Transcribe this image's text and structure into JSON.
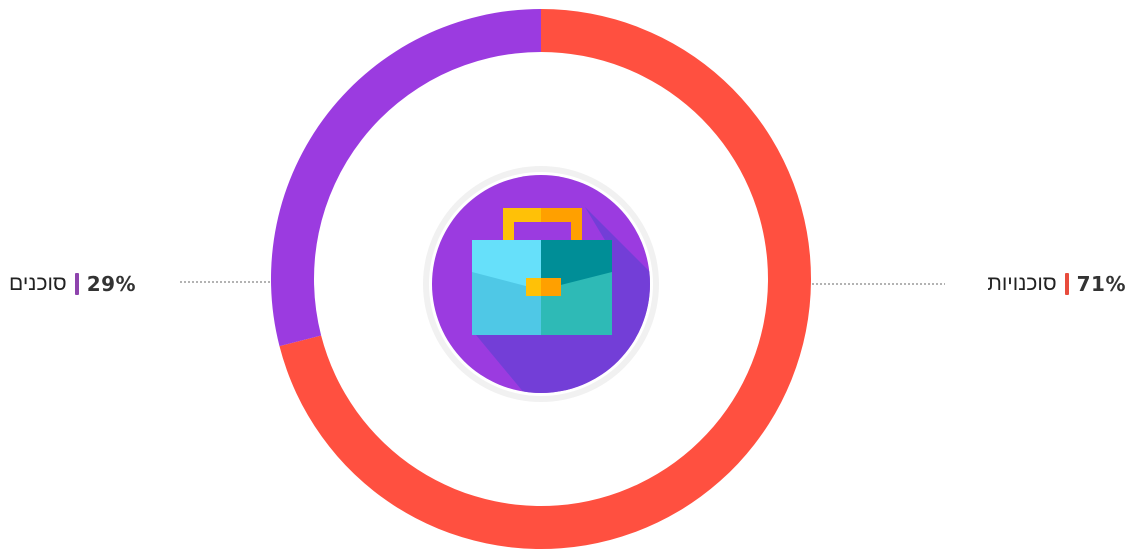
{
  "chart_data": {
    "type": "pie",
    "donut": true,
    "series": [
      {
        "name": "סוכנויות",
        "value": 71,
        "value_label": "71%",
        "color": "#FF5040"
      },
      {
        "name": "סוכנים",
        "value": 29,
        "value_label": "29%",
        "color": "#9B3BE0"
      }
    ],
    "title": "",
    "legend": "leader-line labels left and right",
    "center_icon": "briefcase-icon"
  },
  "colors": {
    "agencies": "#FF5040",
    "agents": "#9B3BE0",
    "agencies_label_bar": "#E84C3D",
    "agents_label_bar": "#8E44AD",
    "icon_circle": "#9B3BE0",
    "icon_shadow": "#6F3FD6"
  }
}
